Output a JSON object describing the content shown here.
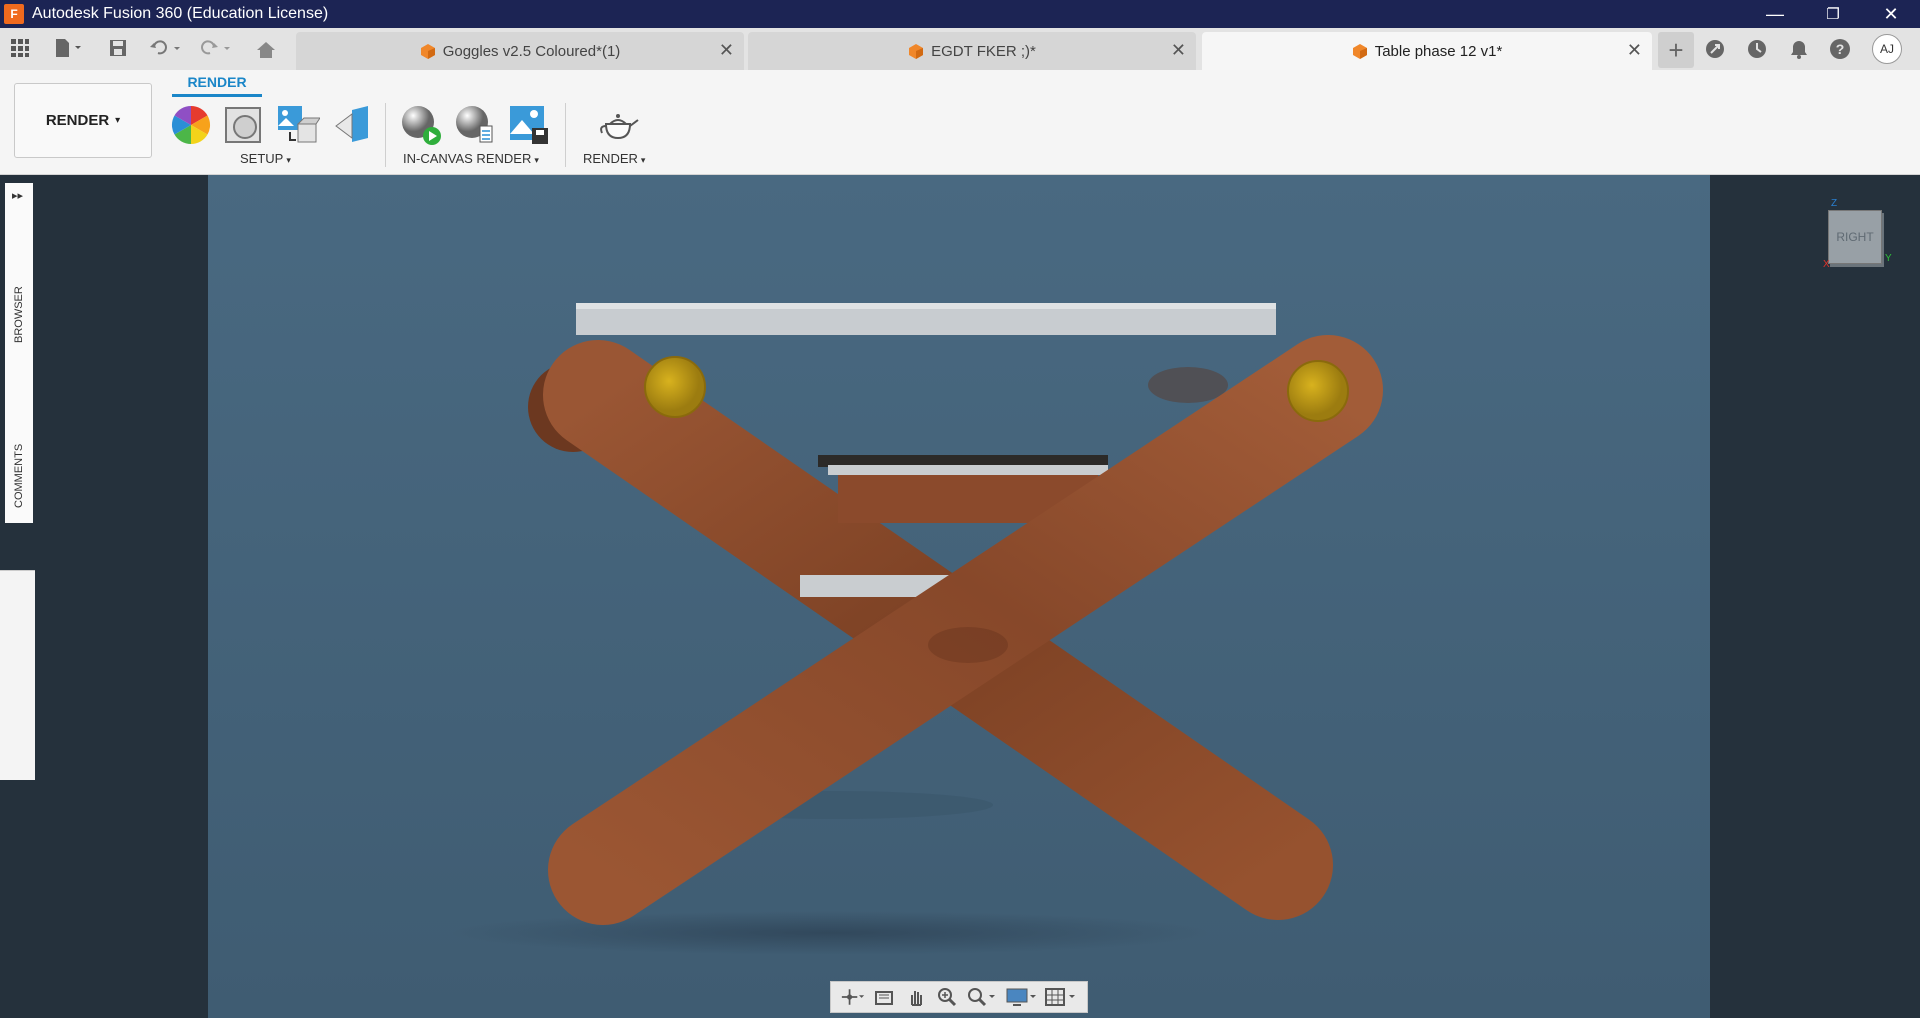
{
  "window": {
    "title": "Autodesk Fusion 360 (Education License)",
    "app_icon_letter": "F",
    "minimize": "—",
    "restore": "❐",
    "close": "✕"
  },
  "tabs": [
    {
      "label": "Goggles v2.5 Coloured*(1)",
      "active": false
    },
    {
      "label": "EGDT FKER ;)*",
      "active": false
    },
    {
      "label": "Table phase 12 v1*",
      "active": true
    }
  ],
  "tab_close": "✕",
  "new_tab": "+",
  "user": {
    "initials": "AJ"
  },
  "toolbar": {
    "workspace": "RENDER",
    "active_tab": "RENDER",
    "groups": {
      "setup": "SETUP",
      "in_canvas_render": "IN-CANVAS RENDER",
      "render": "RENDER"
    },
    "caret": "▾"
  },
  "side_panel": {
    "expand": "▸▸",
    "browser": "BROWSER",
    "comments": "COMMENTS"
  },
  "viewcube": {
    "face": "RIGHT",
    "axis_x": "X",
    "axis_y": "Y",
    "axis_z": "Z"
  },
  "colors": {
    "titlebar": "#1c2454",
    "accent": "#1a86c8",
    "viewport": "#44627a",
    "wood": "#8a4a2c",
    "bolt": "#c09a16"
  },
  "icons": [
    "apps-grid-icon",
    "file-icon",
    "save-icon",
    "undo-icon",
    "redo-icon",
    "home-icon",
    "appearance-icon",
    "scene-settings-icon",
    "texture-map-icon",
    "decal-icon",
    "in-canvas-render-icon",
    "render-settings-icon",
    "capture-image-icon",
    "render-teapot-icon",
    "extensions-icon",
    "job-status-icon",
    "notifications-icon",
    "help-icon",
    "orbit-icon",
    "look-at-icon",
    "pan-icon",
    "zoom-icon",
    "fit-icon",
    "display-settings-icon",
    "grid-icon"
  ]
}
